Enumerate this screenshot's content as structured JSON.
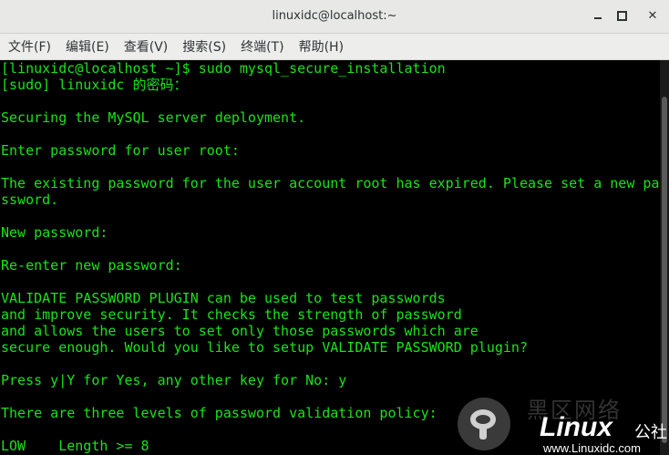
{
  "window": {
    "title": "linuxidc@localhost:~",
    "minimize_glyph": "",
    "close_glyph": "✕"
  },
  "menu": [
    "文件(F)",
    "编辑(E)",
    "查看(V)",
    "搜索(S)",
    "终端(T)",
    "帮助(H)"
  ],
  "terminal": {
    "text_color": "#1ae31a",
    "background": "#000000",
    "lines": [
      "[linuxidc@localhost ~]$ sudo mysql_secure_installation",
      "[sudo] linuxidc 的密码：",
      "",
      "Securing the MySQL server deployment.",
      "",
      "Enter password for user root:",
      "",
      "The existing password for the user account root has expired. Please set a new pa",
      "ssword.",
      "",
      "New password:",
      "",
      "Re-enter new password:",
      "",
      "VALIDATE PASSWORD PLUGIN can be used to test passwords",
      "and improve security. It checks the strength of password",
      "and allows the users to set only those passwords which are",
      "secure enough. Would you like to setup VALIDATE PASSWORD plugin?",
      "",
      "Press y|Y for Yes, any other key for No: y",
      "",
      "There are three levels of password validation policy:",
      "",
      "LOW    Length >= 8"
    ]
  },
  "watermark": {
    "cn_text": "黑区网络",
    "brand": "Linux",
    "brand_suffix": "公社",
    "url": "www.Linuxidc.com"
  }
}
